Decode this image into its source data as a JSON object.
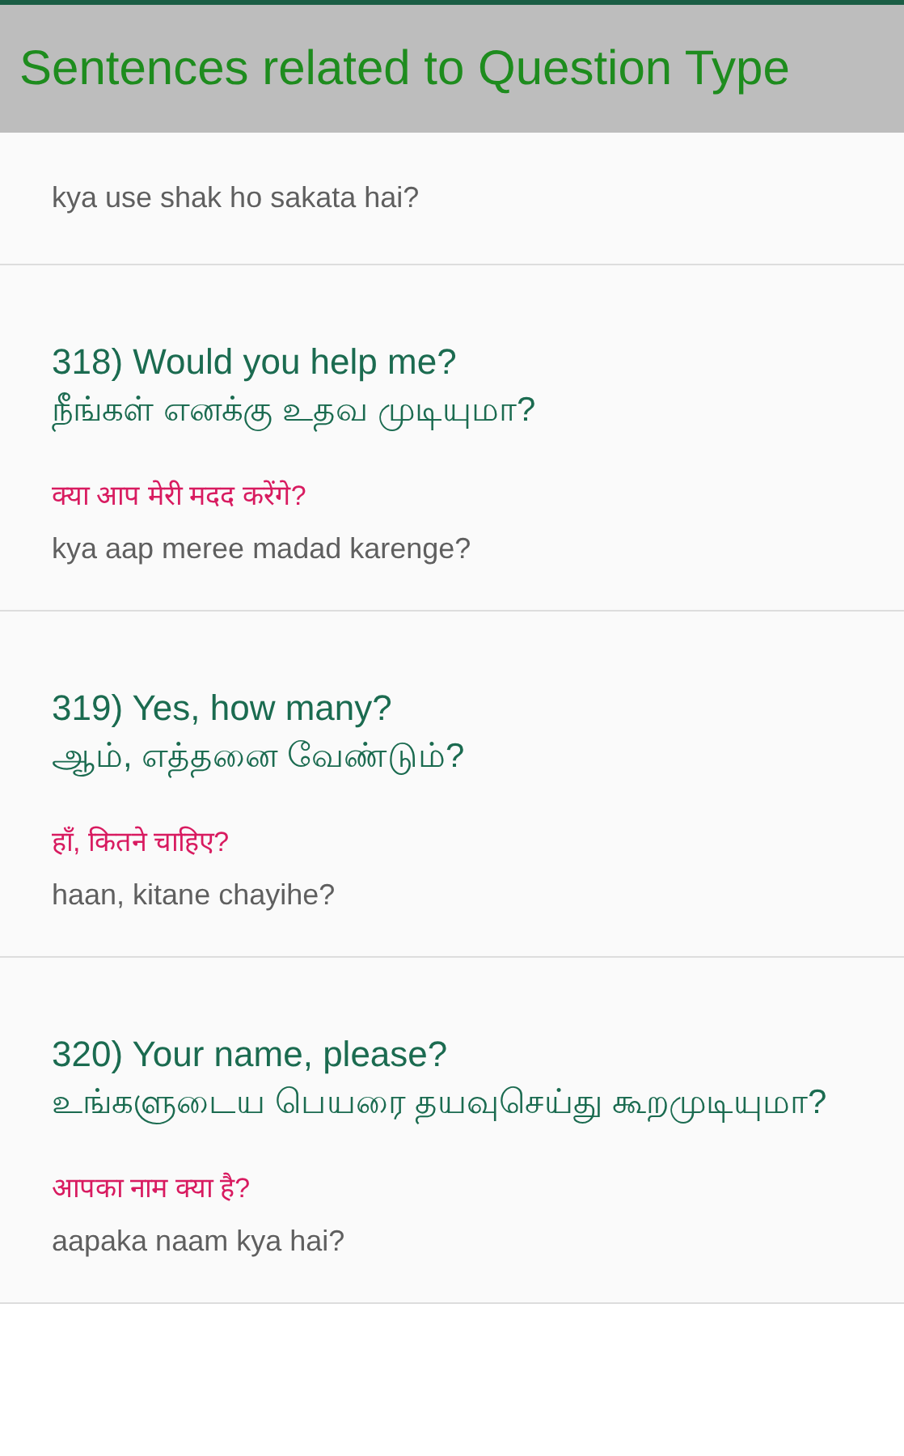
{
  "header": {
    "title": "Sentences related to Question Type"
  },
  "sentences": [
    {
      "transliteration": "kya use shak ho sakata hai?"
    },
    {
      "english": "318) Would you help me?",
      "tamil": "நீங்கள் எனக்கு உதவ முடியுமா?",
      "hindi": "क्या आप मेरी मदद करेंगे?",
      "transliteration": "kya aap meree madad karenge?"
    },
    {
      "english": "319) Yes, how many?",
      "tamil": "ஆம், எத்தனை வேண்டும்?",
      "hindi": "हाँ, कितने चाहिए?",
      "transliteration": "haan, kitane chayihe?"
    },
    {
      "english": "320) Your name, please?",
      "tamil": "உங்களுடைய பெயரை தயவுசெய்து கூறமுடியுமா?",
      "hindi": "आपका नाम क्या है?",
      "transliteration": "aapaka naam kya hai?"
    }
  ]
}
